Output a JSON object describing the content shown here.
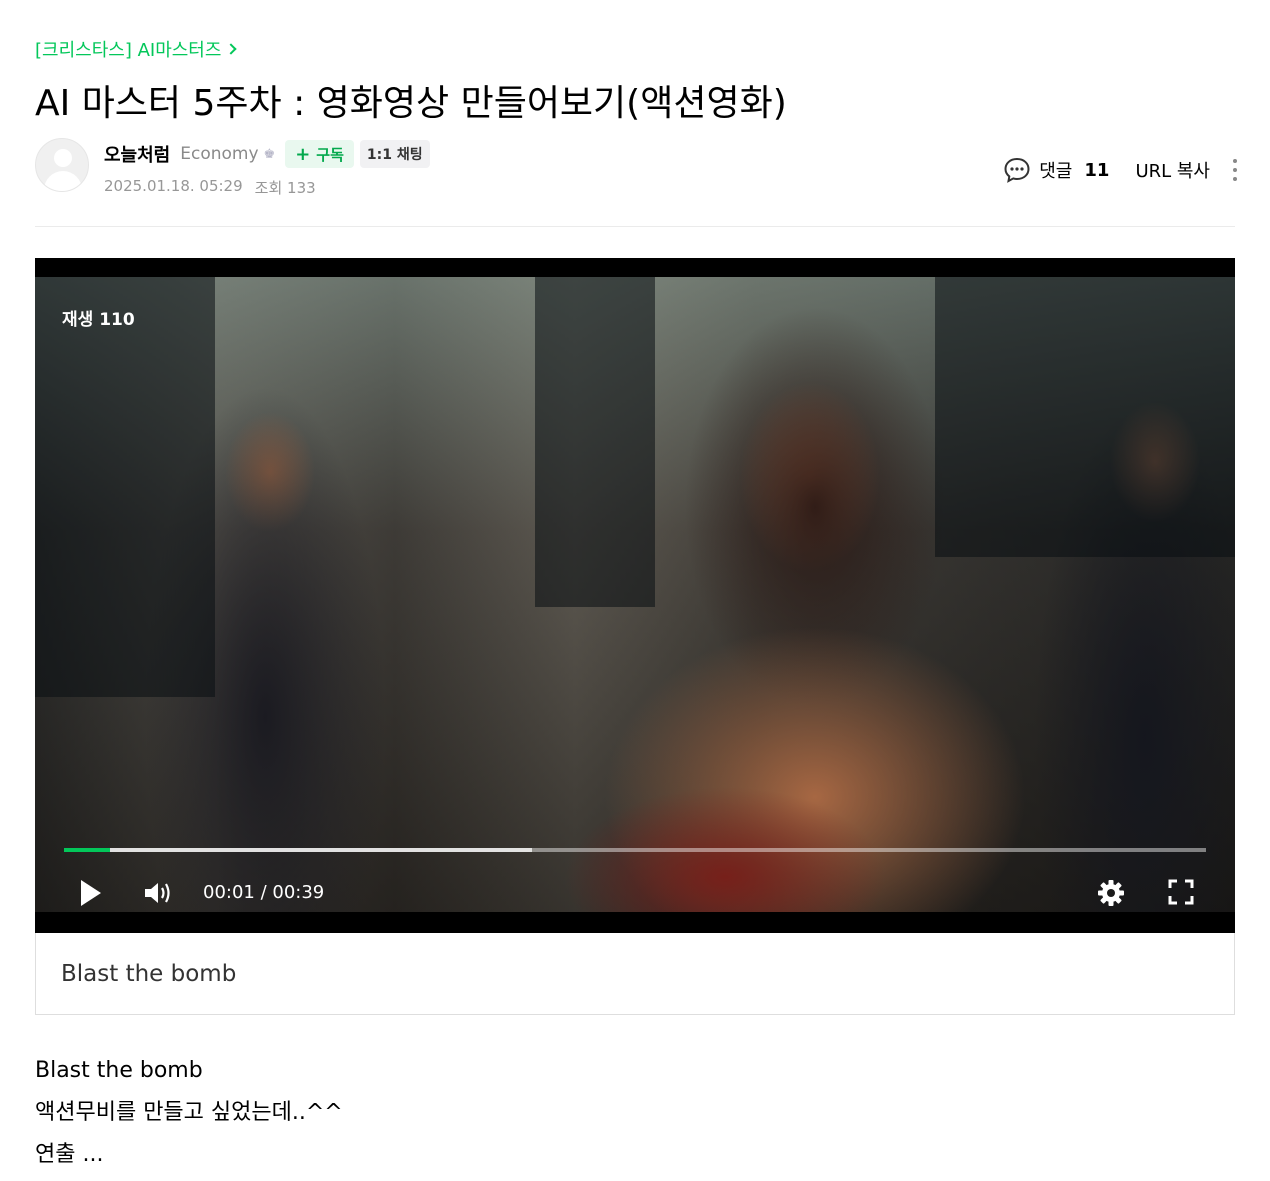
{
  "breadcrumb": {
    "board": "[크리스타스] AI마스터즈"
  },
  "post": {
    "title": "AI 마스터 5주차 : 영화영상 만들어보기(액션영화)",
    "author": {
      "name": "오늘처럼",
      "level": "Economy",
      "level_icon": "crown-icon",
      "subscribe_label": "구독",
      "chat_label": "1:1 채팅"
    },
    "date": "2025.01.18. 05:29",
    "views_label": "조회 133"
  },
  "tools": {
    "comment_label": "댓글",
    "comment_count": "11",
    "url_copy_label": "URL 복사"
  },
  "video": {
    "play_count": "재생 110",
    "time": "00:01 / 00:39",
    "progress_fraction": 0.04,
    "buffered_fraction": 0.41,
    "caption": "Blast the bomb",
    "accent_color": "#03c75a"
  },
  "content": {
    "lines": [
      "Blast the bomb",
      "액션무비를 만들고 싶었는데..^^",
      "연출 ..."
    ]
  }
}
